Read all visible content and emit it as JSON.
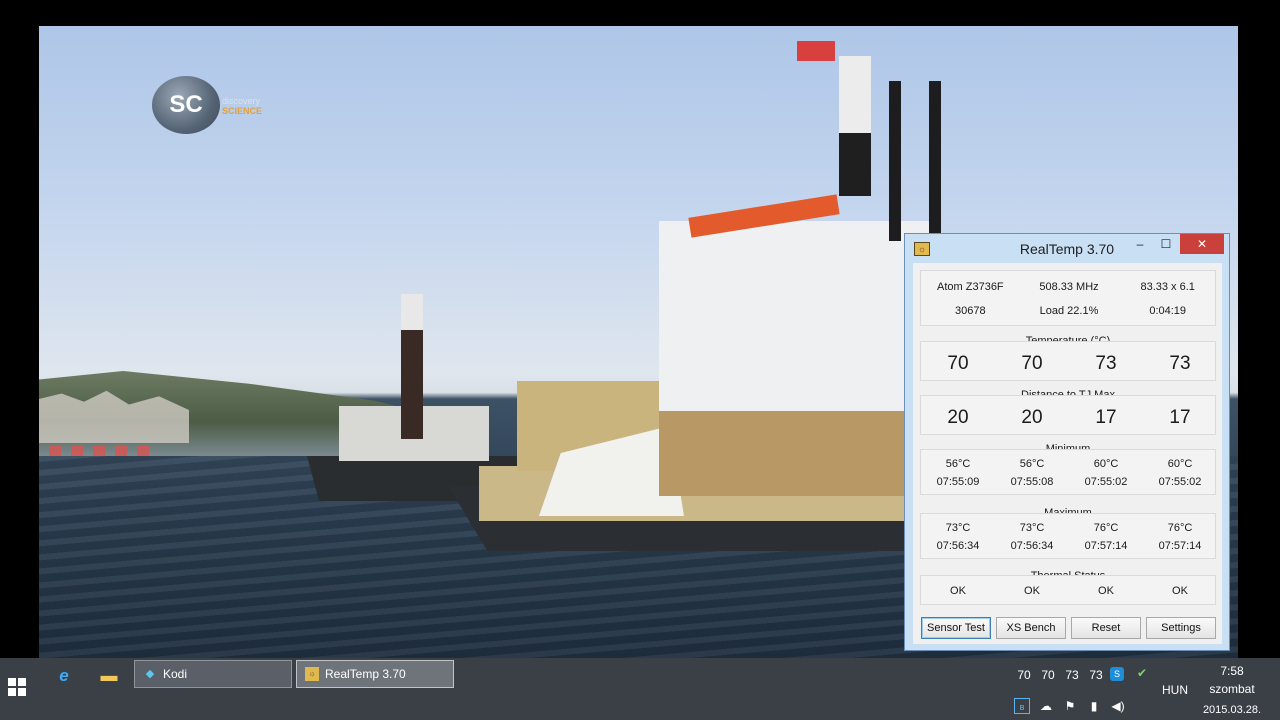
{
  "video": {
    "channel_logo_abbr": "SC",
    "channel_logo_name": "discovery",
    "channel_logo_sub": "SCIENCE"
  },
  "realtemp": {
    "title": "RealTemp 3.70",
    "controls": {
      "minimize": "–",
      "maximize": "☐",
      "close": "✕"
    },
    "info": {
      "cpu": "Atom Z3736F",
      "freq": "508.33 MHz",
      "multiplier": "83.33 x 6.1",
      "score": "30678",
      "load": "Load  22.1%",
      "uptime": "0:04:19"
    },
    "temperature": {
      "label": "Temperature (°C)",
      "values": [
        "70",
        "70",
        "73",
        "73"
      ]
    },
    "distance": {
      "label": "Distance to TJ Max",
      "values": [
        "20",
        "20",
        "17",
        "17"
      ]
    },
    "minimum": {
      "label": "Minimum",
      "temps": [
        "56°C",
        "56°C",
        "60°C",
        "60°C"
      ],
      "times": [
        "07:55:09",
        "07:55:08",
        "07:55:02",
        "07:55:02"
      ]
    },
    "maximum": {
      "label": "Maximum",
      "temps": [
        "73°C",
        "73°C",
        "76°C",
        "76°C"
      ],
      "times": [
        "07:56:34",
        "07:56:34",
        "07:57:14",
        "07:57:14"
      ]
    },
    "thermal": {
      "label": "Thermal Status",
      "values": [
        "OK",
        "OK",
        "OK",
        "OK"
      ]
    },
    "buttons": {
      "sensor_test": "Sensor Test",
      "xs_bench": "XS Bench",
      "reset": "Reset",
      "settings": "Settings"
    }
  },
  "taskbar": {
    "tasks": [
      {
        "label": "Kodi",
        "icon": "kodi-icon"
      },
      {
        "label": "RealTemp 3.70",
        "icon": "realtemp-icon"
      }
    ],
    "tray": {
      "temps": [
        "70",
        "70",
        "73",
        "73"
      ],
      "language": "HUN",
      "time": "7:58",
      "day": "szombat",
      "date": "2015.03.28."
    }
  }
}
